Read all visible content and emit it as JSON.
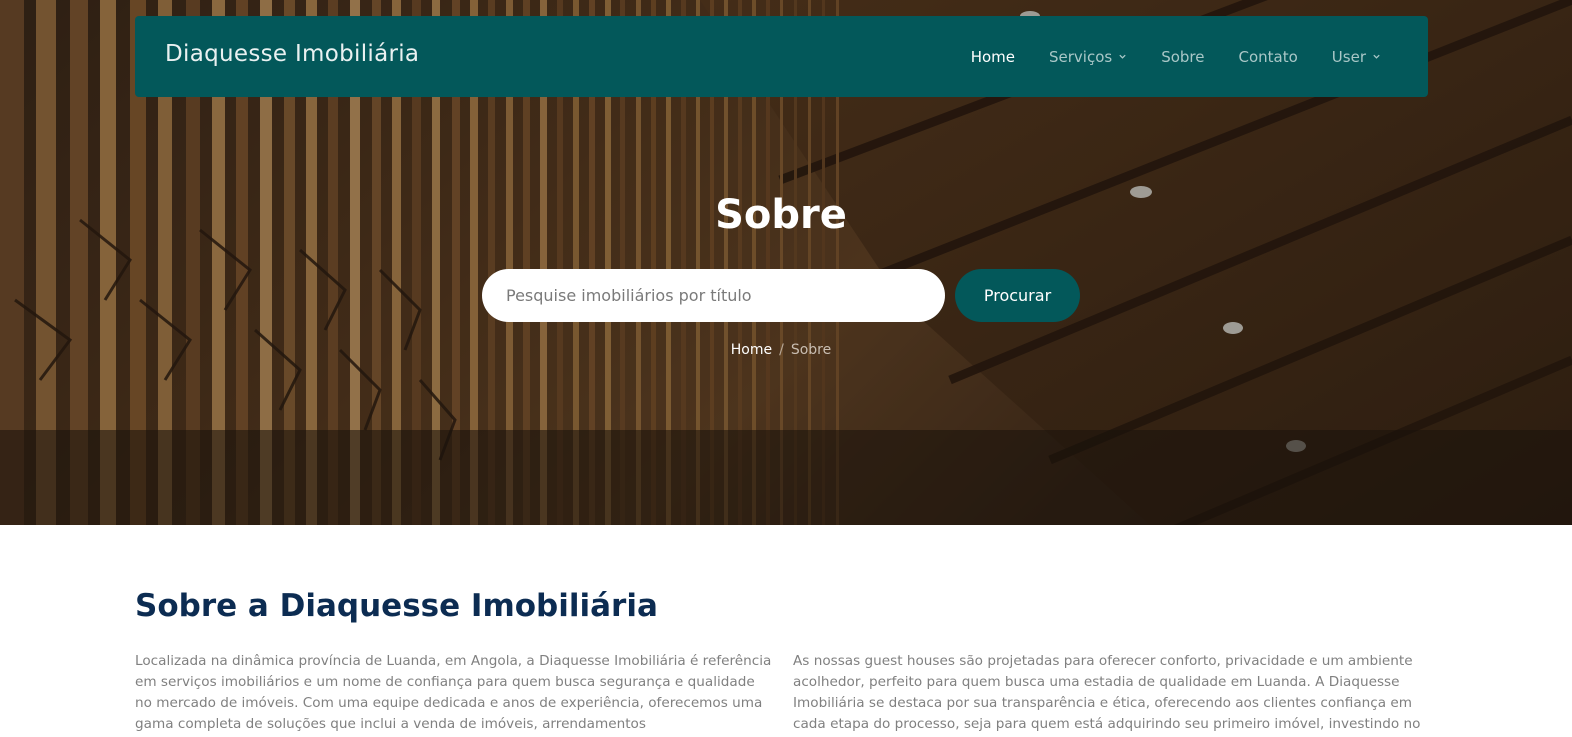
{
  "nav": {
    "brand": "Diaquesse Imobiliária",
    "items": [
      {
        "label": "Home",
        "active": true,
        "dropdown": false
      },
      {
        "label": "Serviços",
        "active": false,
        "dropdown": true
      },
      {
        "label": "Sobre",
        "active": false,
        "dropdown": false
      },
      {
        "label": "Contato",
        "active": false,
        "dropdown": false
      },
      {
        "label": "User",
        "active": false,
        "dropdown": true
      }
    ]
  },
  "hero": {
    "title": "Sobre",
    "search": {
      "placeholder": "Pesquise imobiliários por título",
      "value": "",
      "button": "Procurar"
    },
    "breadcrumb": {
      "home": "Home",
      "separator": "/",
      "current": "Sobre"
    }
  },
  "about": {
    "title": "Sobre a Diaquesse Imobiliária",
    "left_text": "Localizada na dinâmica província de Luanda, em Angola, a Diaquesse Imobiliária é referência em serviços imobiliários e um nome de confiança para quem busca segurança e qualidade no mercado de imóveis. Com uma equipe dedicada e anos de experiência, oferecemos uma gama completa de soluções que inclui a venda de imóveis, arrendamentos",
    "right_text": "As nossas guest houses são projetadas para oferecer conforto, privacidade e um ambiente acolhedor, perfeito para quem busca uma estadia de qualidade em Luanda. A Diaquesse Imobiliária se destaca por sua transparência e ética, oferecendo aos clientes confiança em cada etapa do processo, seja para quem está adquirindo seu primeiro imóvel, investindo no"
  },
  "colors": {
    "primary": "#03585a",
    "heading": "#0c2c52",
    "body_text": "#808080"
  },
  "icons": {
    "dropdown": "chevron-down-icon"
  }
}
